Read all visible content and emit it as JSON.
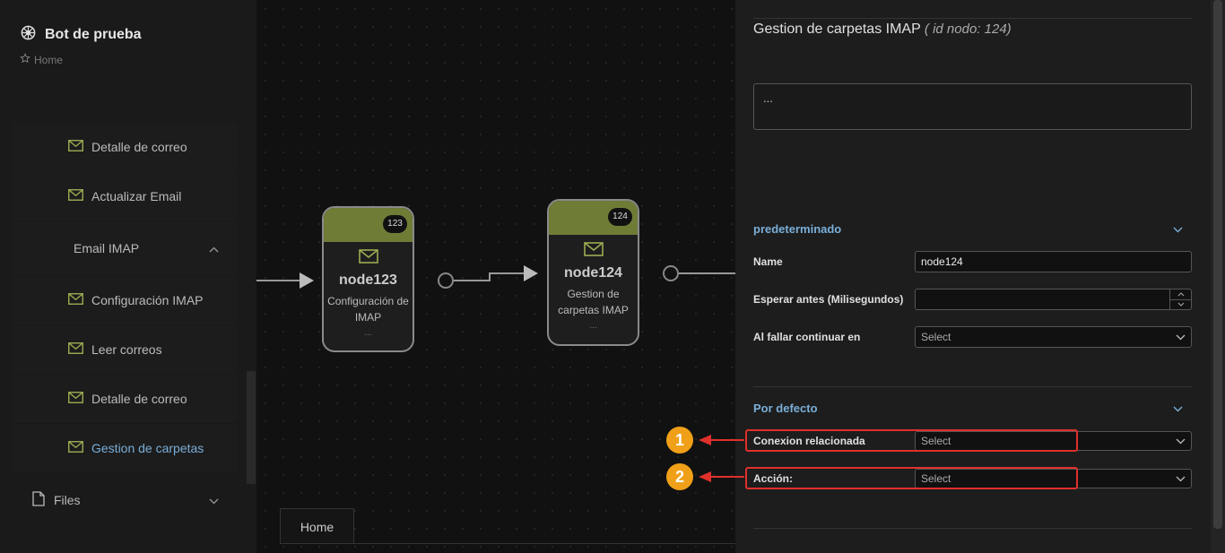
{
  "app": {
    "title": "Bot de prueba",
    "breadcrumb": "Home"
  },
  "sidebar": {
    "items": [
      {
        "label": "Detalle de correo",
        "type": "sub",
        "icon": "mail-icon"
      },
      {
        "label": "Actualizar Email",
        "type": "sub",
        "icon": "mail-icon"
      },
      {
        "label": "Email IMAP",
        "type": "group",
        "icon": "chevron-up-icon"
      },
      {
        "label": "Configuración IMAP",
        "type": "sub",
        "icon": "mail-icon"
      },
      {
        "label": "Leer correos",
        "type": "sub",
        "icon": "mail-icon"
      },
      {
        "label": "Detalle de correo",
        "type": "sub",
        "icon": "mail-icon"
      },
      {
        "label": "Gestion de carpetas",
        "type": "sub",
        "icon": "mail-icon",
        "active": true
      },
      {
        "label": "Files",
        "type": "top",
        "icon": "file-icon"
      }
    ]
  },
  "canvas": {
    "nodes": [
      {
        "badge": "123",
        "name": "node123",
        "desc": "Configuración de IMAP",
        "more": "..."
      },
      {
        "badge": "124",
        "name": "node124",
        "desc": "Gestion de carpetas IMAP",
        "more": "..."
      }
    ],
    "tab": "Home"
  },
  "panel": {
    "title": "Gestion de carpetas IMAP",
    "id_note": "( id nodo: 124)",
    "description": "...",
    "section1": {
      "title": "predeterminado",
      "name_label": "Name",
      "name_value": "node124",
      "wait_label": "Esperar antes (Milisegundos)",
      "wait_value": "",
      "fail_label": "Al fallar continuar en",
      "fail_value": "Select"
    },
    "section2": {
      "title": "Por defecto",
      "conn_label": "Conexion relacionada",
      "conn_value": "Select",
      "action_label": "Acción:",
      "action_value": "Select"
    }
  },
  "annotations": {
    "marker1": "1",
    "marker2": "2",
    "color": "#f0a018",
    "highlight_color": "#e0302b"
  },
  "colors": {
    "node_header": "#6e7c36",
    "accent": "#7aaed8"
  }
}
